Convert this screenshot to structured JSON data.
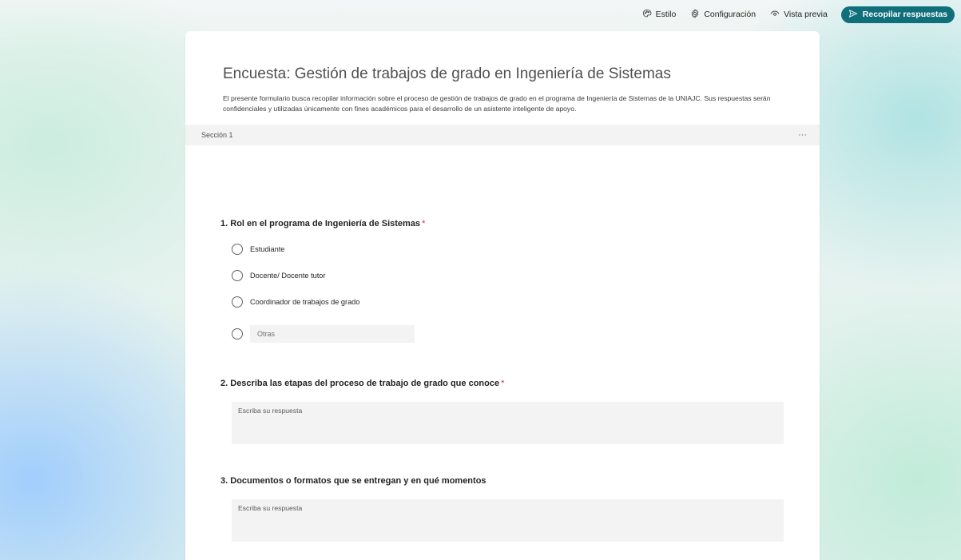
{
  "toolbar": {
    "style_label": "Estilo",
    "settings_label": "Configuración",
    "preview_label": "Vista previa",
    "collect_label": "Recopilar respuestas",
    "accent_color": "#0f6f7b"
  },
  "form": {
    "title": "Encuesta: Gestión de trabajos de grado en Ingeniería de Sistemas",
    "description": "El presente formulario busca recopilar información sobre el proceso de gestión de trabajos de grado en el programa de Ingeniería de Sistemas de la UNIAJC. Sus respuestas serán confidenciales y utilizadas únicamente con fines académicos para el desarrollo de un asistente inteligente de apoyo.",
    "section_label": "Sección 1",
    "more_icon": "···"
  },
  "questions": [
    {
      "number": "1.",
      "title": "Rol en el programa de Ingeniería de Sistemas",
      "required_mark": "*",
      "options": [
        "Estudiante",
        "Docente/ Docente tutor",
        "Coordinador de trabajos de grado"
      ],
      "other_placeholder": "Otras"
    },
    {
      "number": "2.",
      "title": "Describa las etapas del proceso de trabajo de grado que conoce",
      "required_mark": "*",
      "placeholder": "Escriba su respuesta"
    },
    {
      "number": "3.",
      "title": "Documentos o formatos que se entregan y en qué momentos",
      "placeholder": "Escriba su respuesta"
    }
  ]
}
